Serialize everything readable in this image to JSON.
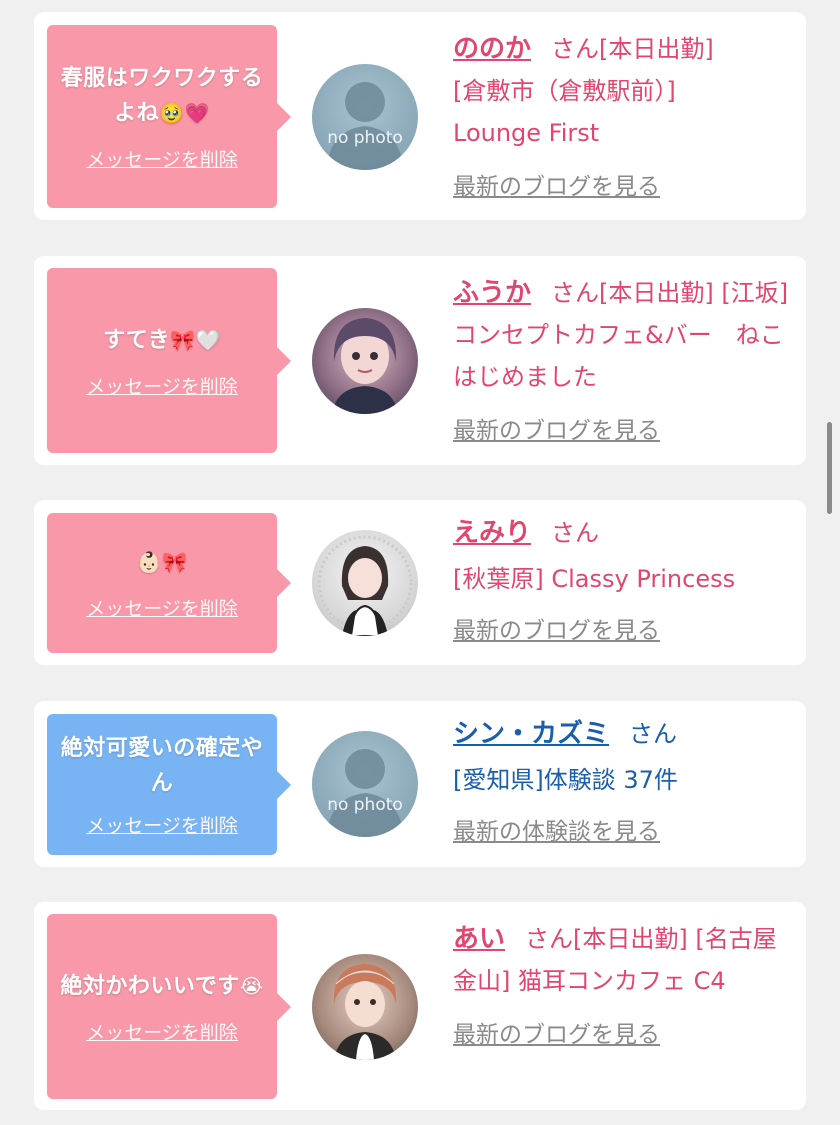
{
  "entries": [
    {
      "message": "春服はワクワクするよね",
      "message_emoji": "🥹💗",
      "delete_label": "メッセージを削除",
      "name": "ののか",
      "san": "さん",
      "status": "[本日出勤]",
      "shop": "[倉敷市（倉敷駅前）] Lounge First",
      "link": "最新のブログを見る",
      "avatar_label": "no photo",
      "bubble_color": "#f898a8"
    },
    {
      "message": "すてき",
      "message_emoji": "🎀🤍",
      "delete_label": "メッセージを削除",
      "name": "ふうか",
      "san": "さん",
      "status": "[本日出勤]",
      "shop": "[江坂] コンセプトカフェ&バー　ねこはじめました",
      "link": "最新のブログを見る",
      "bubble_color": "#f898a8"
    },
    {
      "message": "",
      "message_emoji": "👶🏻🎀",
      "delete_label": "メッセージを削除",
      "name": "えみり",
      "san": "さん",
      "status": "",
      "shop": "[秋葉原] Classy Princess",
      "link": "最新のブログを見る",
      "bubble_color": "#f898a8"
    },
    {
      "message": "絶対可愛いの確定やん",
      "message_emoji": "",
      "delete_label": "メッセージを削除",
      "name": "シン・カズミ",
      "san": "さん",
      "status": "",
      "shop": "[愛知県]体験談 37件",
      "link": "最新の体験談を見る",
      "avatar_label": "no photo",
      "bubble_color": "#78b4f4"
    },
    {
      "message": "絶対かわいいです",
      "message_emoji": "😭",
      "delete_label": "メッセージを削除",
      "name": "あい",
      "san": "さん",
      "status": "[本日出勤]",
      "shop": "[名古屋 金山] 猫耳コンカフェ C4",
      "link": "最新のブログを見る",
      "bubble_color": "#f898a8"
    }
  ],
  "colors": {
    "pink_text": "#e2466e",
    "blue_text": "#1a5fae",
    "link_gray": "#8a8a8a",
    "page_bg": "#f0f0f0"
  }
}
